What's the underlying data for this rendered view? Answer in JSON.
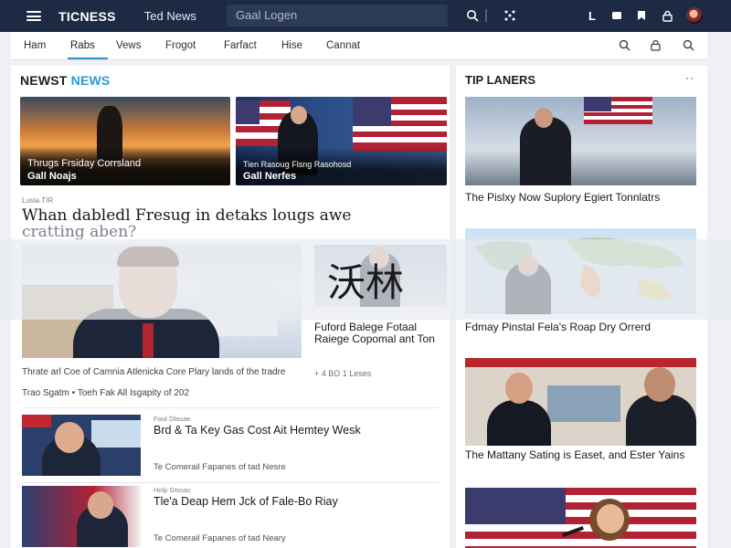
{
  "topbar": {
    "brand": "TICNESS",
    "subbrand": "Ted News",
    "search_placeholder": "Gaal Logen",
    "icons": [
      "menu-icon",
      "search-icon",
      "apps-icon",
      "bell-icon",
      "bookmark-icon",
      "video-icon",
      "lock-icon"
    ],
    "letter": "L"
  },
  "nav": {
    "items": [
      "Ham",
      "Rabs",
      "Vews",
      "Frogot",
      "Farfact",
      "Hise",
      "Cannat"
    ],
    "active_index": 1,
    "accent": "#2c8fc8",
    "icons": [
      "search-icon",
      "lock-icon",
      "search-icon"
    ]
  },
  "main": {
    "section_title_a": "NEWST",
    "section_title_b": "NEWS",
    "accent": "#2b9ad6",
    "hero": [
      {
        "caption": "Thrugs Frsiday Corrsland",
        "name": "Gall Noajs"
      },
      {
        "caption": "Tien Rasoug Flsng Rasohosd",
        "name": "Gall Nerfes"
      }
    ],
    "kicker": "Lusia TIR",
    "headline_a": "Whan dabledl Fresug in detaks lougs awe",
    "headline_b": "cratting aben?",
    "side_story": {
      "title": "Fuford Balege Fotaal Raiege Copomal ant Ton",
      "meta": "+ 4 BO 1 Leses"
    },
    "lead_caption": "Thrate arl Coe of Camnia Atlenicka Core Plary lands of the tradre",
    "lead_meta": "Trao Sgatm •  Toeh Fak All Isgapity of 202",
    "rows": [
      {
        "kicker": "Fout Dlasae",
        "title": "Brd & Ta Key Gas Cost Ait Hemtey Wesk",
        "meta": "Te Comerail Fapanes of tad Nesre"
      },
      {
        "kicker": "Holp Gtssac",
        "title": "Tle'a Deap Hem Jck of Fale-Bo Riay",
        "meta": "Te Comerail Fapanes of tad Neary"
      }
    ]
  },
  "rail": {
    "title": "TIP LANERS",
    "more": "··",
    "stories": [
      {
        "title": "The Pislxy Now Suplory Egiert Tonnlatrs"
      },
      {
        "title": "Fdmay Pinstal Fela's Roap Dry Orrerd"
      },
      {
        "title": "The Mattany Sating is Easet, and Ester Yains"
      }
    ]
  },
  "overlay": {
    "text": "沃林"
  }
}
